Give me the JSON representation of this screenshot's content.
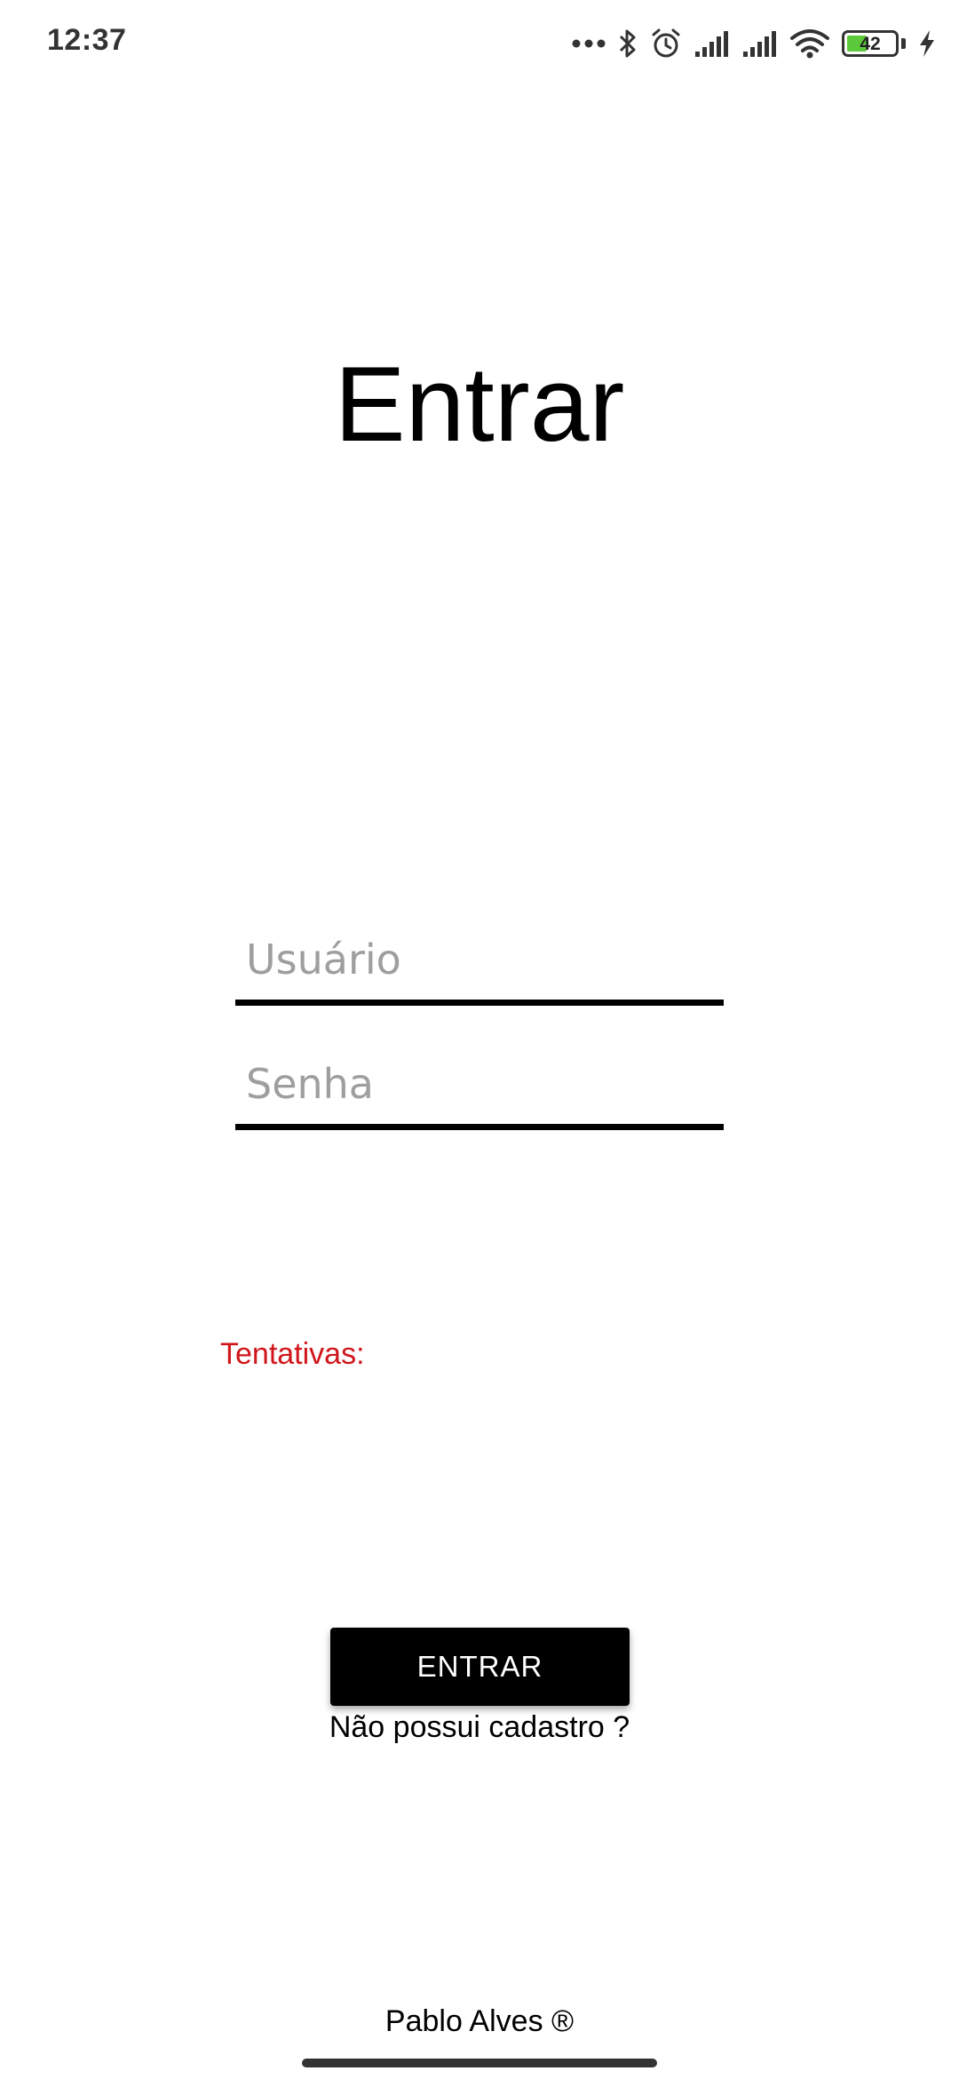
{
  "status_bar": {
    "time": "12:37",
    "battery_level": "42",
    "battery_fraction": 0.42,
    "icons": [
      "more-dots-icon",
      "bluetooth-icon",
      "alarm-icon",
      "signal-icon",
      "signal-icon",
      "wifi-icon",
      "battery-icon",
      "charging-icon"
    ]
  },
  "login": {
    "title": "Entrar",
    "username_placeholder": "Usuário",
    "username_value": "",
    "password_placeholder": "Senha",
    "password_value": "",
    "attempts_label": "Tentativas:",
    "submit_label": "ENTRAR",
    "signup_link": "Não possui cadastro ?"
  },
  "footer": {
    "credit": "Pablo Alves ®"
  },
  "colors": {
    "background": "#ffffff",
    "text": "#000000",
    "attempts_text": "#d0161b",
    "button_bg": "#000000",
    "button_text": "#ffffff",
    "battery_fill": "#5cc93a",
    "placeholder": "#9e9e9e"
  }
}
